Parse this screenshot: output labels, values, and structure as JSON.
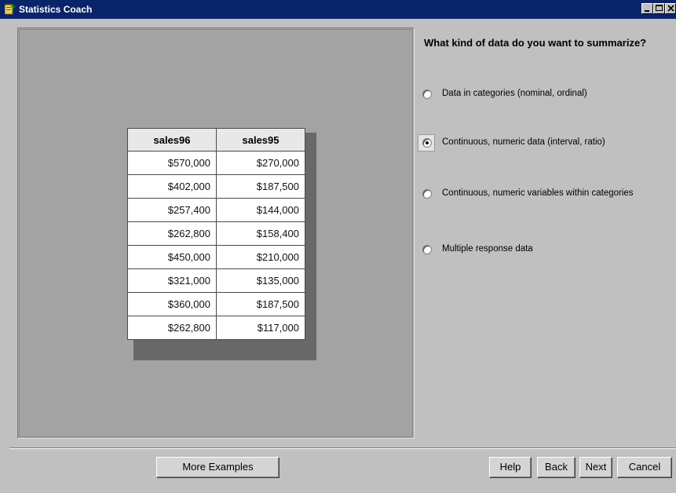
{
  "window": {
    "title": "Statistics Coach"
  },
  "example_table": {
    "headers": [
      "sales96",
      "sales95"
    ],
    "rows": [
      [
        "$570,000",
        "$270,000"
      ],
      [
        "$402,000",
        "$187,500"
      ],
      [
        "$257,400",
        "$144,000"
      ],
      [
        "$262,800",
        "$158,400"
      ],
      [
        "$450,000",
        "$210,000"
      ],
      [
        "$321,000",
        "$135,000"
      ],
      [
        "$360,000",
        "$187,500"
      ],
      [
        "$262,800",
        "$117,000"
      ]
    ]
  },
  "question": "What kind of data do you want to summarize?",
  "options": [
    {
      "label": "Data in categories (nominal, ordinal)",
      "selected": false
    },
    {
      "label": "Continuous, numeric data (interval, ratio)",
      "selected": true
    },
    {
      "label": "Continuous, numeric variables within categories",
      "selected": false
    },
    {
      "label": "Multiple response data",
      "selected": false
    }
  ],
  "buttons": {
    "more_examples": "More Examples",
    "help": "Help",
    "back": "Back",
    "next": "Next",
    "cancel": "Cancel"
  },
  "colors": {
    "titlebar": "#0a246a",
    "face": "#c0c0c0",
    "panel": "#a3a3a3"
  }
}
